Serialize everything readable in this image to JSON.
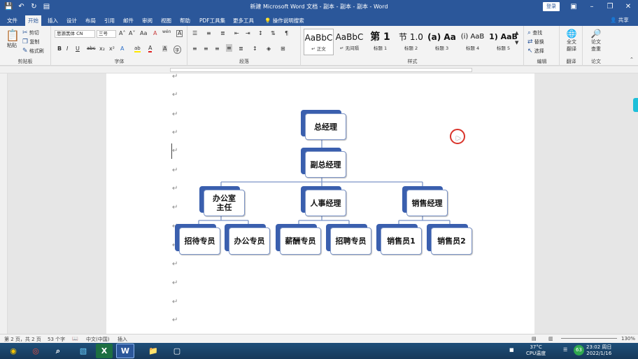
{
  "titlebar": {
    "title": "新建 Microsoft Word 文档 - 副本 - 副本 - 副本 - Word",
    "login": "登录",
    "qat_icons": [
      "save-icon",
      "undo-icon",
      "redo-icon",
      "autosave-icon"
    ],
    "window_buttons": [
      "ribbon-display-icon",
      "minimize-icon",
      "restore-icon",
      "close-icon"
    ]
  },
  "tabs": [
    {
      "label": "文件"
    },
    {
      "label": "开始"
    },
    {
      "label": "插入"
    },
    {
      "label": "设计"
    },
    {
      "label": "布局"
    },
    {
      "label": "引用"
    },
    {
      "label": "邮件"
    },
    {
      "label": "审阅"
    },
    {
      "label": "视图"
    },
    {
      "label": "帮助"
    },
    {
      "label": "PDF工具集"
    },
    {
      "label": "更多工具"
    },
    {
      "label": "操作说明搜索"
    }
  ],
  "active_tab": "开始",
  "share": "共享",
  "ribbon": {
    "clipboard": {
      "label": "剪贴板",
      "paste": "粘贴",
      "cut": "剪切",
      "copy": "复制",
      "format_painter": "格式刷"
    },
    "font": {
      "label": "字体",
      "font_name": "思源黑体 CN",
      "font_size": "三号",
      "font_size_grow": "A˄",
      "font_size_shrink": "A˅",
      "change_case": "Aa",
      "clear_format": "A",
      "phonetic": "wén",
      "char_border": "A",
      "bold": "B",
      "italic": "I",
      "underline": "U",
      "strike": "abc",
      "subscript": "x₂",
      "superscript": "x²",
      "text_effects": "A",
      "highlight": "ab",
      "font_color": "A",
      "char_shading": "A",
      "enclose": "字"
    },
    "paragraph": {
      "label": "段落"
    },
    "styles": {
      "label": "样式",
      "items": [
        {
          "sample": "AaBbC",
          "name": "↵ 正文"
        },
        {
          "sample": "AaBbC",
          "name": "↵ 无间隔"
        },
        {
          "sample": "第 1",
          "name": "标题 1"
        },
        {
          "sample": "节 1.0",
          "name": "标题 2"
        },
        {
          "sample": "(a) Aa",
          "name": "标题 3"
        },
        {
          "sample": "(i) AaB",
          "name": "标题 4"
        },
        {
          "sample": "1) AaB",
          "name": "标题 5"
        }
      ]
    },
    "editing": {
      "label": "编辑",
      "find": "查找",
      "replace": "替换",
      "select": "选择"
    },
    "translate": {
      "label": "翻译",
      "full_text": "全文",
      "translate": "翻译"
    },
    "paper": {
      "label": "论文",
      "check": "论文",
      "check2": "查重"
    }
  },
  "orgchart": {
    "ceo": "总经理",
    "vp": "副总经理",
    "departments": [
      "办公室主任",
      "人事经理",
      "销售经理"
    ],
    "staff": [
      "招待专员",
      "办公专员",
      "薪酬专员",
      "招聘专员",
      "销售员1",
      "销售员2"
    ],
    "accent": "#3a5fae",
    "line_color": "#7c94c6"
  },
  "statusbar": {
    "page": "第 2 页，共 2 页",
    "words": "53 个字",
    "language": "中文(中国)",
    "mode": "插入",
    "zoom": "130%"
  },
  "taskbar": {
    "apps": [
      "start-orb-icon",
      "chrome-icon",
      "search-icon",
      "app-icon",
      "excel-icon",
      "word-icon",
      "folder-icon",
      "record-icon"
    ],
    "temp": "37°C",
    "temp_label": "CPU温度",
    "time": "23:02 周日",
    "date": "2022/1/16",
    "cpu": "63"
  }
}
